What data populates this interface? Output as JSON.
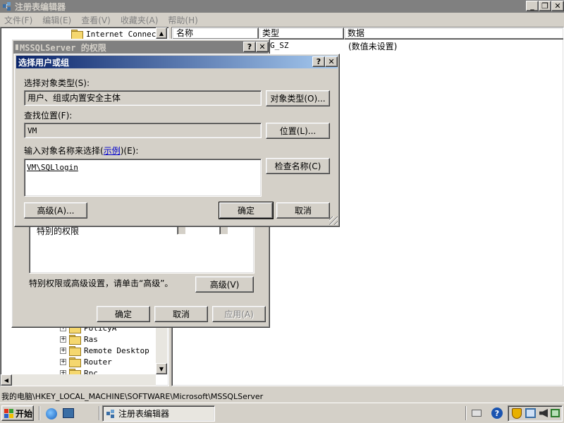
{
  "app": {
    "title": "注册表编辑器"
  },
  "menu": [
    {
      "label": "文件(F)"
    },
    {
      "label": "编辑(E)"
    },
    {
      "label": "查看(V)"
    },
    {
      "label": "收藏夹(A)"
    },
    {
      "label": "帮助(H)"
    }
  ],
  "tree": {
    "items_top": [
      {
        "label": "Internet Connecti"
      }
    ],
    "items_bottom": [
      {
        "label": "PolicyA"
      },
      {
        "label": "Ras"
      },
      {
        "label": "Remote Desktop"
      },
      {
        "label": "Router"
      },
      {
        "label": "Rpc"
      }
    ]
  },
  "list": {
    "headers": {
      "name": "名称",
      "type": "类型",
      "data": "数据"
    },
    "rows": [
      {
        "name": "",
        "type": "G_SZ",
        "data": "(数值未设置)"
      }
    ]
  },
  "status": {
    "path": "我的电脑\\HKEY_LOCAL_MACHINE\\SOFTWARE\\Microsoft\\MSSQLServer"
  },
  "perm_dialog": {
    "title": "MSSQLServer 的权限",
    "special_label": "特别的权限",
    "advanced_hint": "特别权限或高级设置，请单击“高级”。",
    "advanced_btn": "高级(V)",
    "ok_btn": "确定",
    "cancel_btn": "取消",
    "apply_btn": "应用(A)"
  },
  "select_dialog": {
    "title": "选择用户或组",
    "object_type_label": "选择对象类型(S):",
    "object_type_value": "用户、组或内置安全主体",
    "object_type_btn": "对象类型(O)...",
    "location_label": "查找位置(F):",
    "location_value": "VM",
    "location_btn": "位置(L)...",
    "enter_names_label_pre": "输入对象名称来选择(",
    "enter_names_link": "示例",
    "enter_names_label_post": ")(E):",
    "names_value": "VM\\SQLlogin",
    "check_names_btn": "检查名称(C)",
    "advanced_btn": "高级(A)...",
    "ok_btn": "确定",
    "cancel_btn": "取消"
  },
  "taskbar": {
    "start": "开始",
    "task": "注册表编辑器"
  },
  "icons": {
    "regedit": "regedit-icon",
    "ie": "internet-explorer-icon",
    "desktop": "show-desktop-icon",
    "help": "help-icon",
    "shield": "security-shield-icon",
    "network": "network-icon",
    "speaker": "volume-icon"
  }
}
